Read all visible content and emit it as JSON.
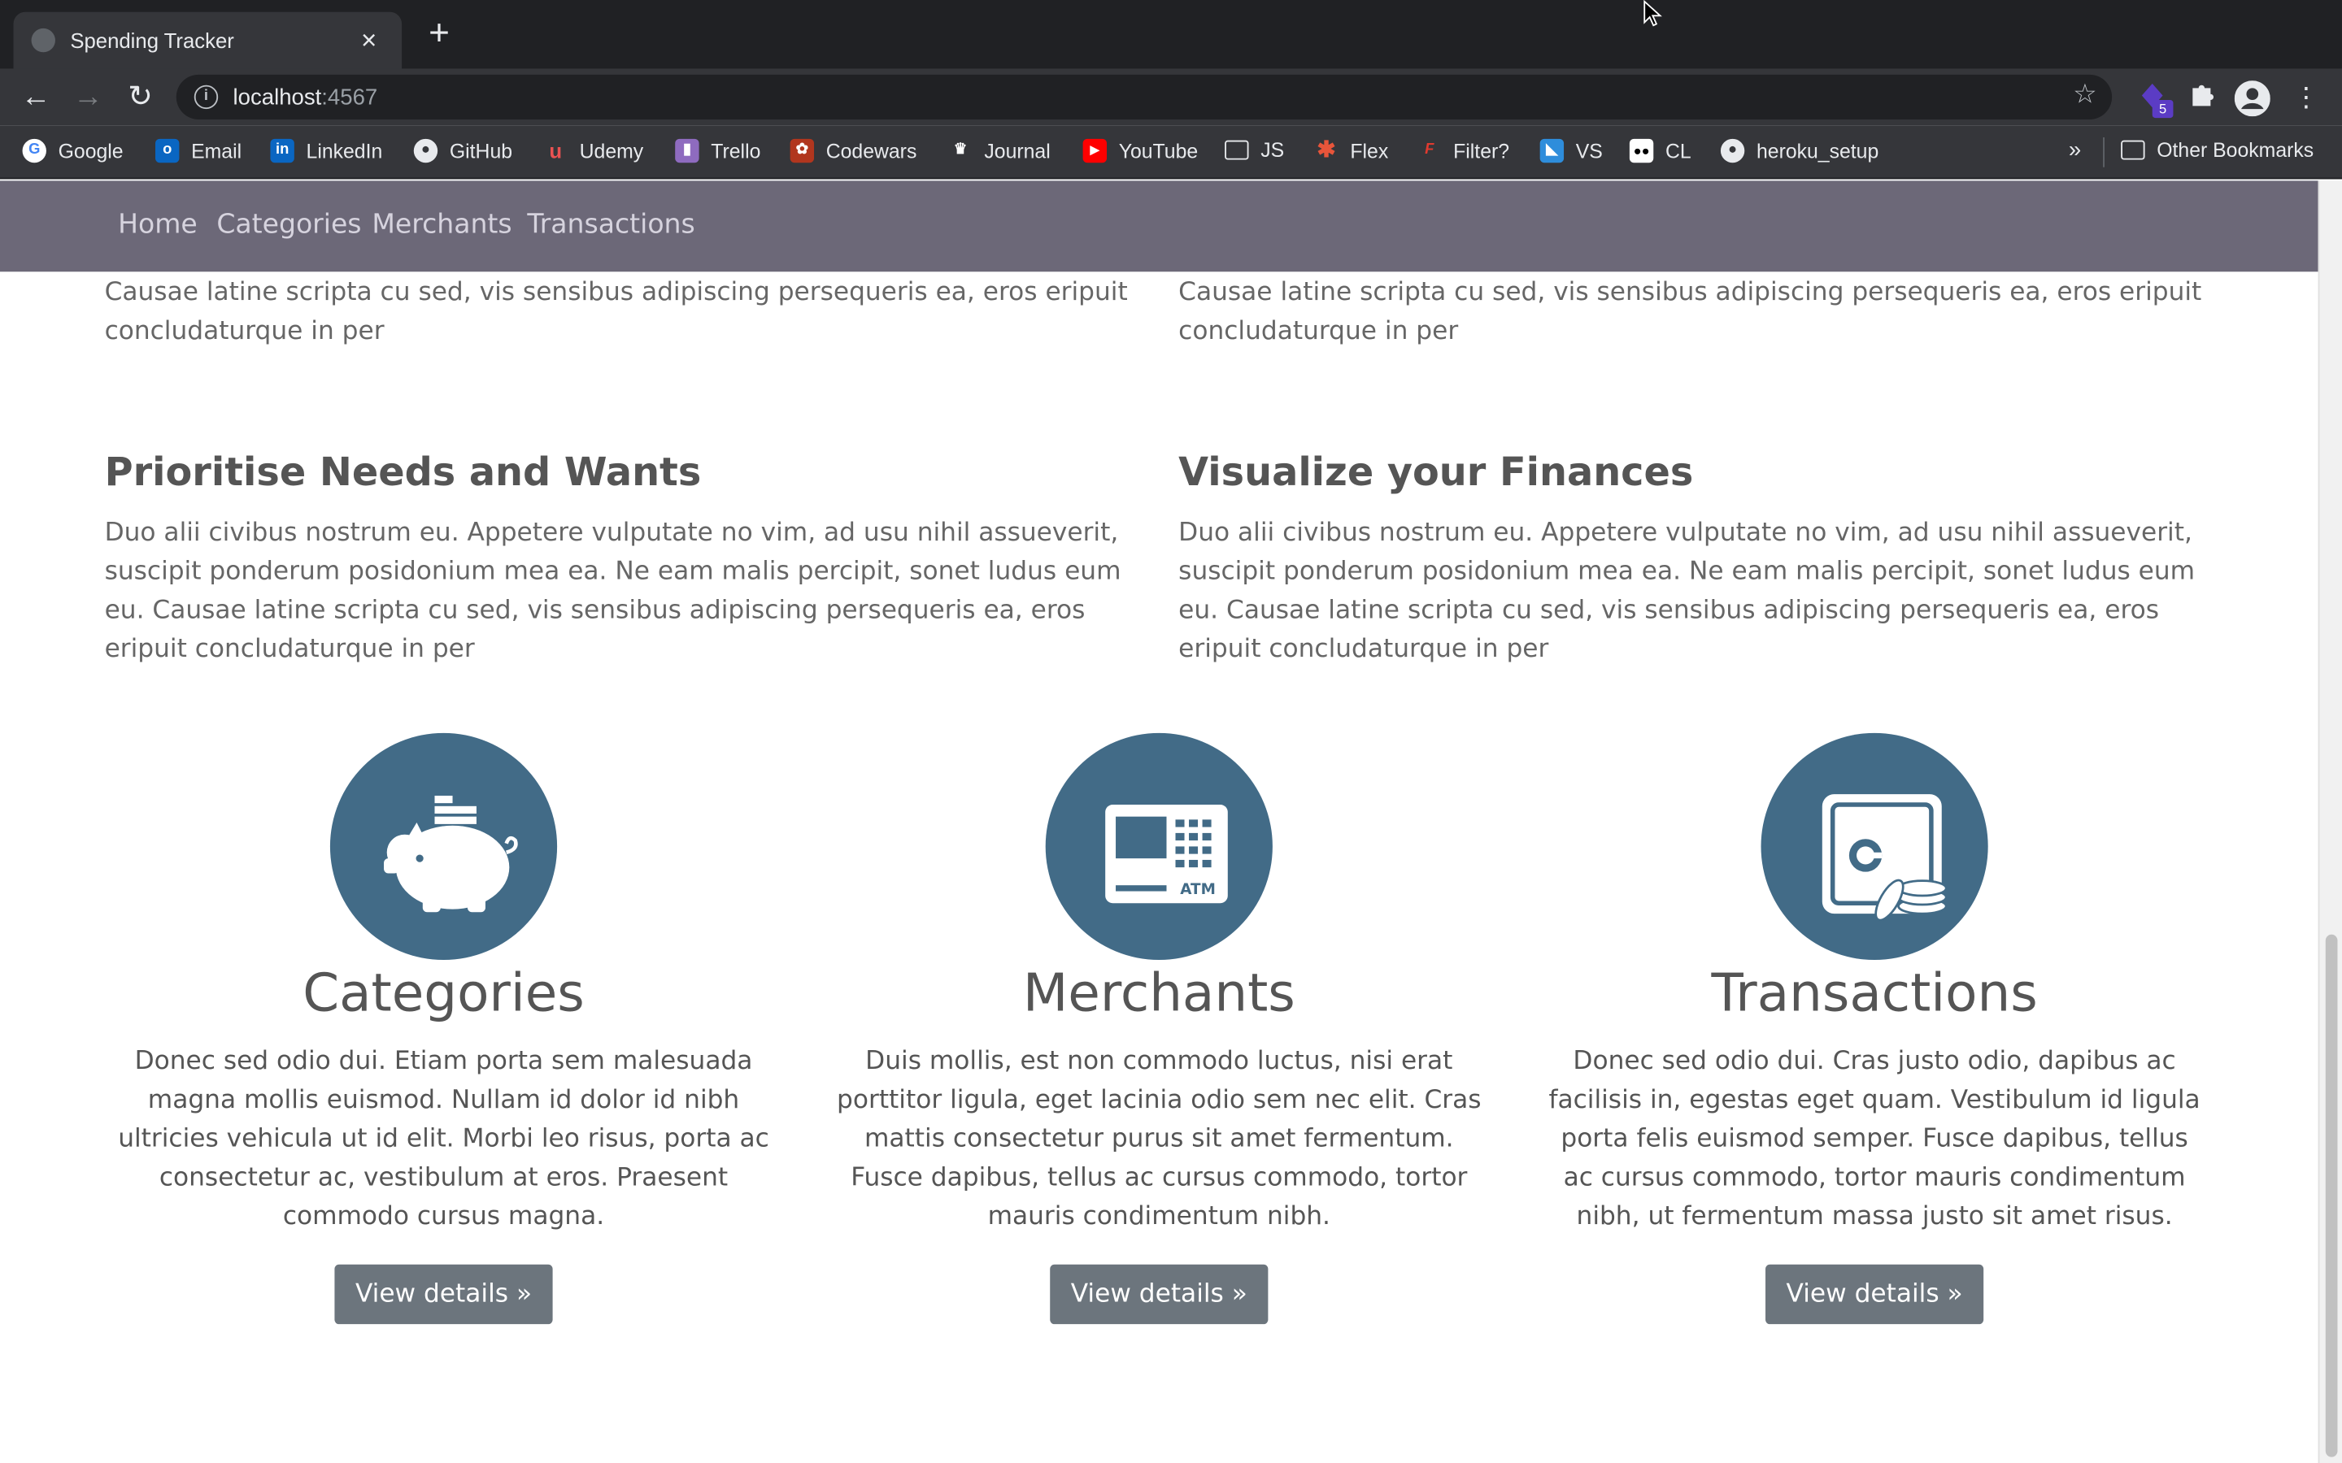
{
  "browser": {
    "tab_title": "Spending Tracker",
    "url_host": "localhost",
    "url_port": ":4567",
    "extension_badge": "5",
    "bookmarks": [
      {
        "label": "Google",
        "color": "#ffffff"
      },
      {
        "label": "Email",
        "color": "#0a66c2"
      },
      {
        "label": "LinkedIn",
        "color": "#0a66c2"
      },
      {
        "label": "GitHub",
        "color": "#e8eaed"
      },
      {
        "label": "Udemy",
        "color": "#ea5252"
      },
      {
        "label": "Trello",
        "color": "#8e6bbf"
      },
      {
        "label": "Codewars",
        "color": "#b1361e"
      },
      {
        "label": "Journal",
        "color": "#ffffff"
      },
      {
        "label": "YouTube",
        "color": "#ff0000"
      },
      {
        "label": "JS",
        "color": "#e8eaed"
      },
      {
        "label": "Flex",
        "color": "#e8553a"
      },
      {
        "label": "Filter?",
        "color": "#e03a2f"
      },
      {
        "label": "VS",
        "color": "#2e8ddb"
      },
      {
        "label": "CL",
        "color": "#ffffff"
      },
      {
        "label": "heroku_setup",
        "color": "#e8eaed"
      }
    ],
    "bookmarks_overflow": "»",
    "other_bookmarks": "Other Bookmarks"
  },
  "nav": {
    "links": [
      "Home",
      "Categories",
      "Merchants",
      "Transactions"
    ]
  },
  "features": {
    "top_left_text": "Causae latine scripta cu sed, vis sensibus adipiscing persequeris ea, eros eripuit concludaturque in per",
    "top_right_text": "Causae latine scripta cu sed, vis sensibus adipiscing persequeris ea, eros eripuit concludaturque in per",
    "left_title": "Prioritise Needs and Wants",
    "left_text": "Duo alii civibus nostrum eu. Appetere vulputate no vim, ad usu nihil assueverit, suscipit ponderum posidonium mea ea. Ne eam malis percipit, sonet ludus eum eu. Causae latine scripta cu sed, vis sensibus adipiscing persequeris ea, eros eripuit concludaturque in per",
    "right_title": "Visualize your Finances",
    "right_text": "Duo alii civibus nostrum eu. Appetere vulputate no vim, ad usu nihil assueverit, suscipit ponderum posidonium mea ea. Ne eam malis percipit, sonet ludus eum eu. Causae latine scripta cu sed, vis sensibus adipiscing persequeris ea, eros eripuit concludaturque in per"
  },
  "columns": [
    {
      "icon": "piggy-bank-icon",
      "title": "Categories",
      "text": "Donec sed odio dui. Etiam porta sem malesuada magna mollis euismod. Nullam id dolor id nibh ultricies vehicula ut id elit. Morbi leo risus, porta ac consectetur ac, vestibulum at eros. Praesent commodo cursus magna.",
      "button": "View details »"
    },
    {
      "icon": "atm-icon",
      "title": "Merchants",
      "text": "Duis mollis, est non commodo luctus, nisi erat porttitor ligula, eget lacinia odio sem nec elit. Cras mattis consectetur purus sit amet fermentum. Fusce dapibus, tellus ac cursus commodo, tortor mauris condimentum nibh.",
      "button": "View details »"
    },
    {
      "icon": "safe-coins-icon",
      "title": "Transactions",
      "text": "Donec sed odio dui. Cras justo odio, dapibus ac facilisis in, egestas eget quam. Vestibulum id ligula porta felis euismod semper. Fusce dapibus, tellus ac cursus commodo, tortor mauris condimentum nibh, ut fermentum massa justo sit amet risus.",
      "button": "View details »"
    }
  ],
  "theme": {
    "navbar_bg": "#6c6878",
    "icon_circle": "#426b87",
    "button_bg": "#6c757d"
  }
}
